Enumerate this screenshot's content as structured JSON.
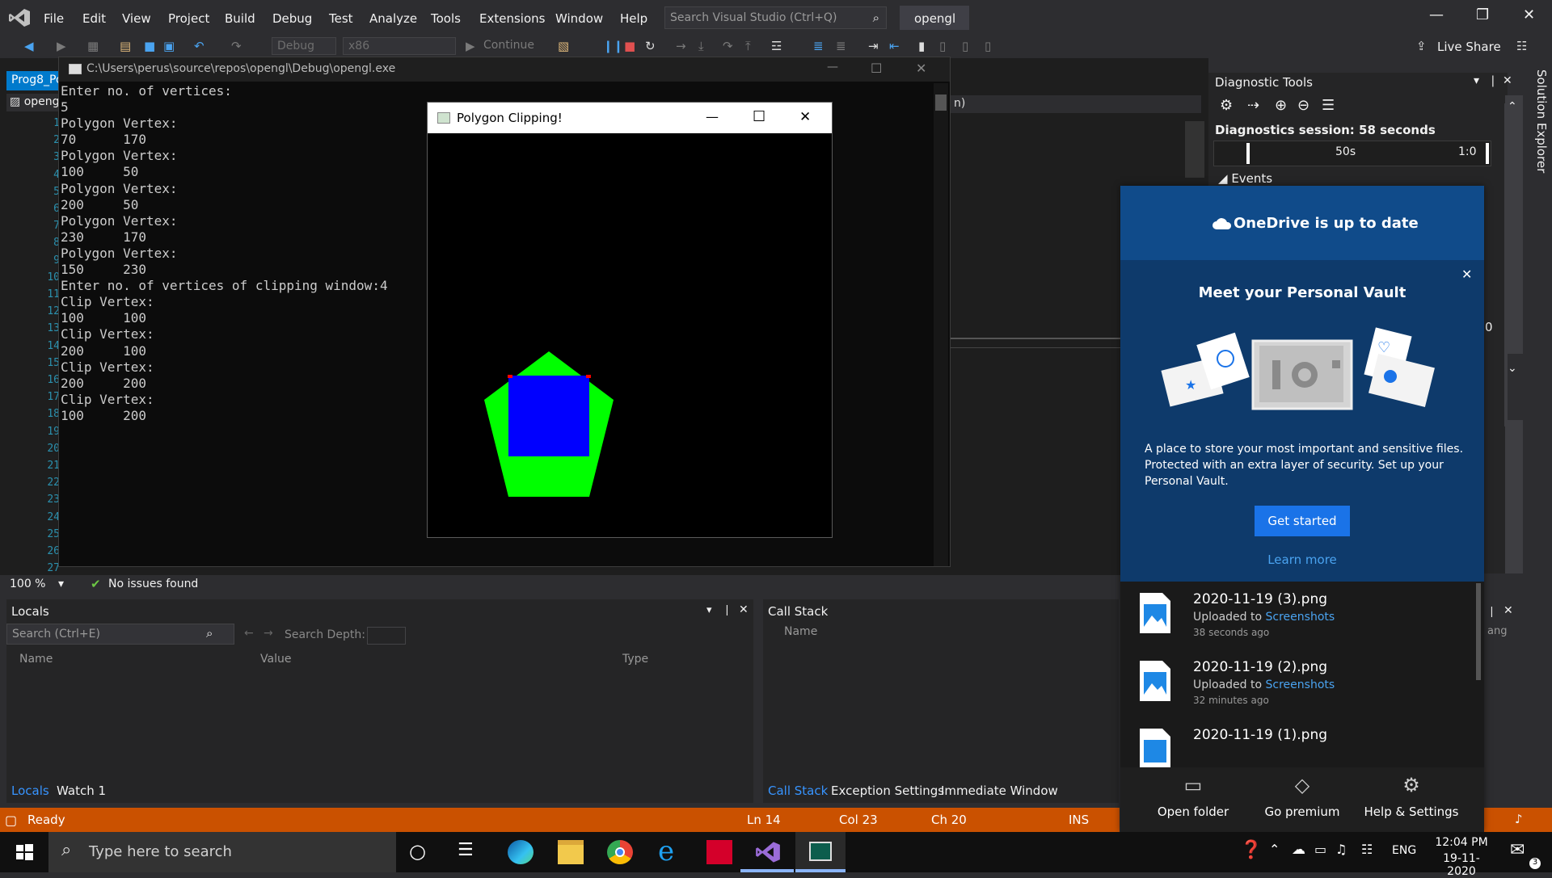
{
  "vs": {
    "menu": [
      "File",
      "Edit",
      "View",
      "Project",
      "Build",
      "Debug",
      "Test",
      "Analyze",
      "Tools",
      "Extensions",
      "Window",
      "Help"
    ],
    "search_placeholder": "Search Visual Studio (Ctrl+Q)",
    "solution_name": "opengl",
    "toolbar": {
      "config": "Debug",
      "platform": "x86",
      "continue_label": "Continue",
      "live_share": "Live Share"
    },
    "doc_tab": "Prog8_Po",
    "nav_project": "openg",
    "nav_right": "n)",
    "line_numbers": [
      "1",
      "2",
      "3",
      "4",
      "5",
      "6",
      "7",
      "8",
      "9",
      "10",
      "11",
      "12",
      "13",
      "14",
      "15",
      "16",
      "17",
      "18",
      "19",
      "20",
      "21",
      "22",
      "23",
      "24",
      "25",
      "26",
      "27"
    ],
    "zoom": "100 %",
    "issues": "No issues found",
    "status": {
      "ready": "Ready",
      "ln": "Ln 14",
      "col": "Col 23",
      "ch": "Ch 20",
      "ins": "INS"
    }
  },
  "console": {
    "title": "C:\\Users\\perus\\source\\repos\\opengl\\Debug\\opengl.exe",
    "lines": [
      "Enter no. of vertices:",
      "5",
      "Polygon Vertex:",
      "70      170",
      "Polygon Vertex:",
      "100     50",
      "Polygon Vertex:",
      "200     50",
      "Polygon Vertex:",
      "230     170",
      "Polygon Vertex:",
      "150     230",
      "Enter no. of vertices of clipping window:4",
      "Clip Vertex:",
      "100     100",
      "Clip Vertex:",
      "200     100",
      "Clip Vertex:",
      "200     200",
      "Clip Vertex:",
      "100     200"
    ]
  },
  "gl_window": {
    "title": "Polygon Clipping!",
    "polygon_color": "#00ff00",
    "clip_color": "#0000ff",
    "corner_color": "#ff0000"
  },
  "diagnostics": {
    "title": "Diagnostic Tools",
    "session": "Diagnostics session: 58 seconds",
    "tick_50": "50s",
    "tick_1": "1:0",
    "events": "Events",
    "solution_explorer": "Solution Explorer",
    "edge_value": "0"
  },
  "locals": {
    "title": "Locals",
    "search_placeholder": "Search (Ctrl+E)",
    "search_depth": "Search Depth:",
    "columns": [
      "Name",
      "Value",
      "Type"
    ],
    "tabs": [
      "Locals",
      "Watch 1"
    ]
  },
  "callstack": {
    "title": "Call Stack",
    "column": "Name",
    "tabs": [
      "Call Stack",
      "Exception Settings",
      "Immediate Window"
    ],
    "edge_text": "ang"
  },
  "onedrive": {
    "header": "OneDrive is up to date",
    "promo_title": "Meet your Personal Vault",
    "promo_body": "A place to store your most important and sensitive files. Protected with an extra layer of security. Set up your Personal Vault.",
    "cta": "Get started",
    "learn_more": "Learn more",
    "files": [
      {
        "name": "2020-11-19 (3).png",
        "uploaded": "Uploaded to",
        "folder": "Screenshots",
        "time": "38 seconds ago"
      },
      {
        "name": "2020-11-19 (2).png",
        "uploaded": "Uploaded to",
        "folder": "Screenshots",
        "time": "32 minutes ago"
      },
      {
        "name": "2020-11-19 (1).png"
      }
    ],
    "footer": [
      "Open folder",
      "Go premium",
      "Help & Settings"
    ]
  },
  "taskbar": {
    "search_placeholder": "Type here to search",
    "lang": "ENG",
    "time": "12:04 PM",
    "date": "19-11-2020",
    "notification_count": "3"
  }
}
